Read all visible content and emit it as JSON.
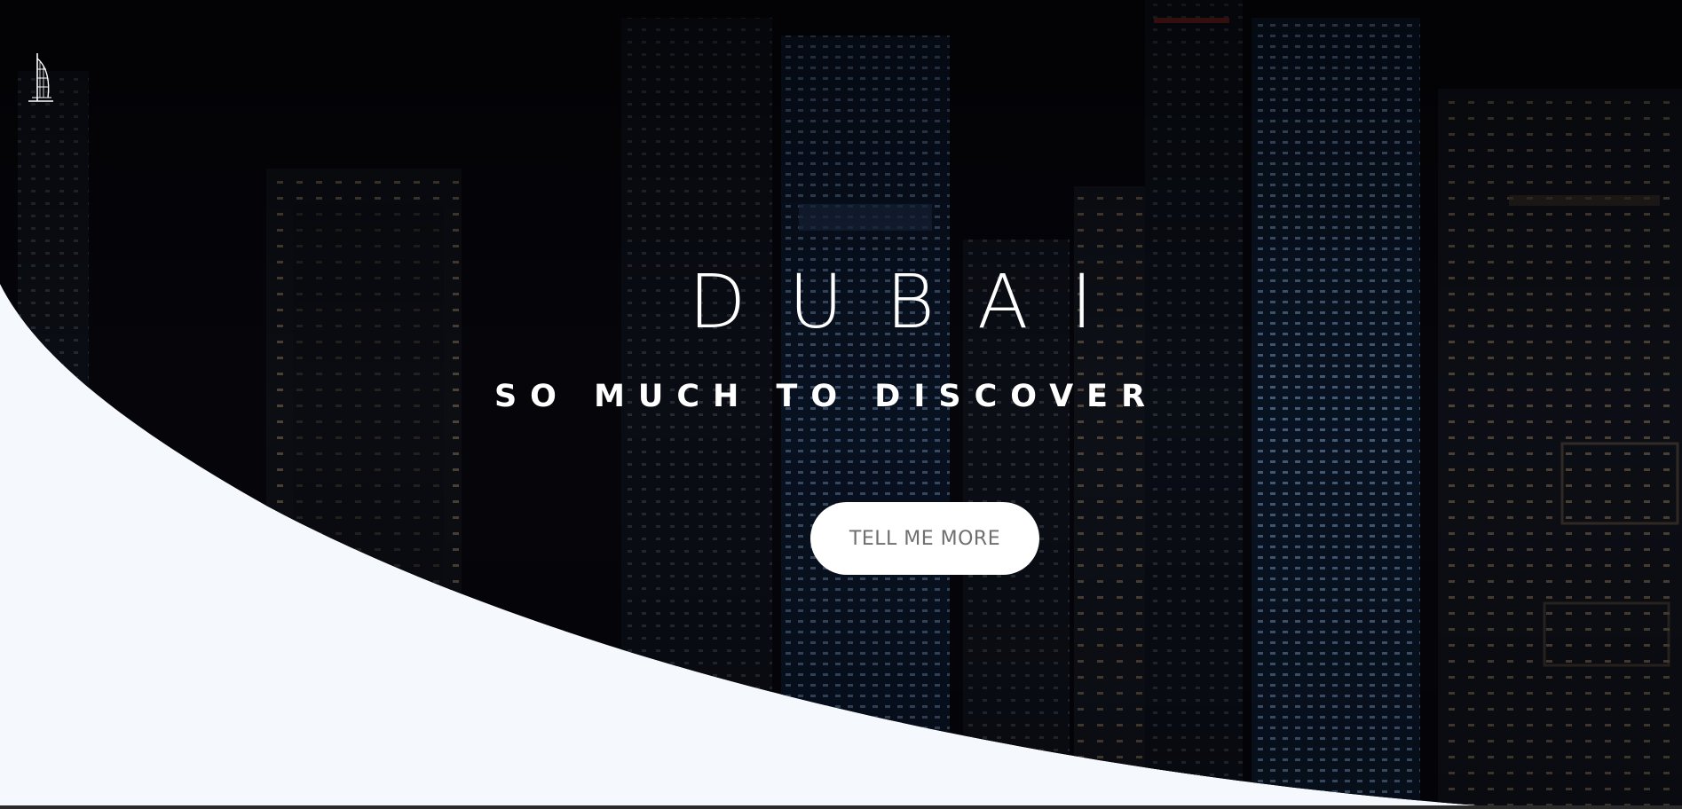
{
  "hero": {
    "title": "DUBAI",
    "subtitle": "SO MUCH TO DISCOVER",
    "cta_label": "TELL ME MORE"
  },
  "logo": {
    "icon": "burj-al-arab-icon"
  },
  "colors": {
    "hero_background": "#06060c",
    "page_background": "#f5f8fd",
    "text": "#ffffff",
    "button_background": "#ffffff",
    "button_text": "#6f6f6f"
  }
}
